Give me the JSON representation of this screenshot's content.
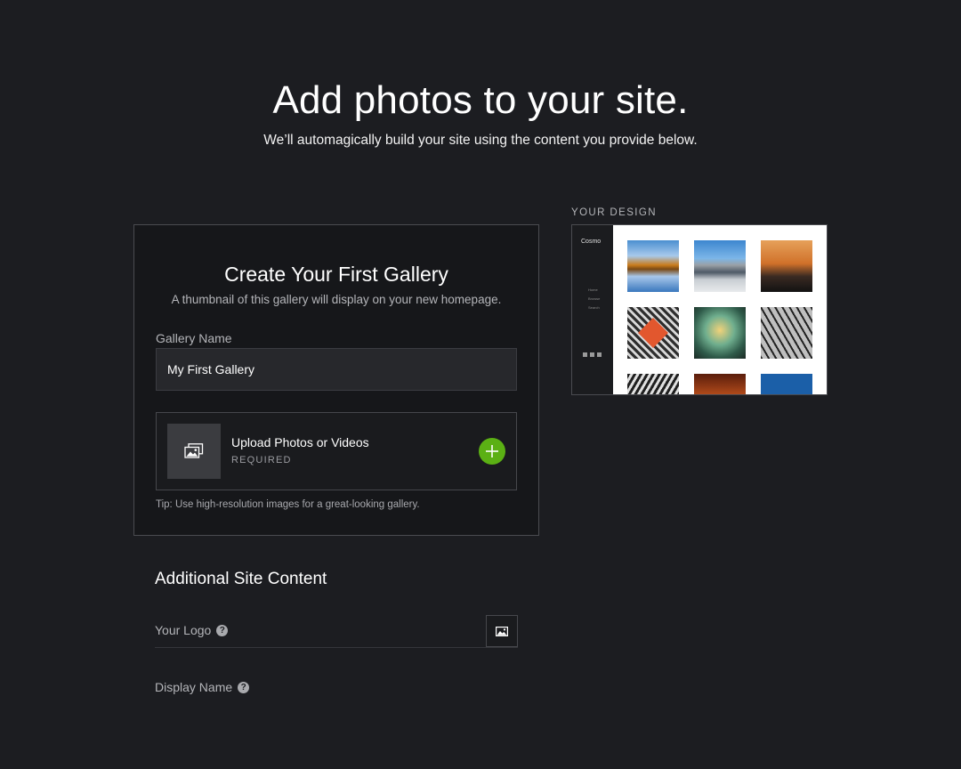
{
  "hero": {
    "title": "Add photos to your site.",
    "subtitle": "We’ll automagically build your site using the content you provide below."
  },
  "gallery_card": {
    "title": "Create Your First Gallery",
    "subtitle": "A thumbnail of this gallery will display on your new homepage.",
    "name_label": "Gallery Name",
    "name_value": "My First Gallery",
    "upload_title": "Upload Photos or Videos",
    "upload_required": "REQUIRED",
    "tip": "Tip: Use high-resolution images for a great-looking gallery."
  },
  "additional": {
    "title": "Additional Site Content",
    "logo_label": "Your Logo",
    "display_name_label": "Display Name",
    "help_glyph": "?"
  },
  "design": {
    "label": "YOUR DESIGN",
    "brand": "Cosmo",
    "nav": [
      "Home",
      "Browse",
      "Search"
    ]
  },
  "colors": {
    "background": "#1c1d21",
    "accent_green": "#5bb014"
  }
}
